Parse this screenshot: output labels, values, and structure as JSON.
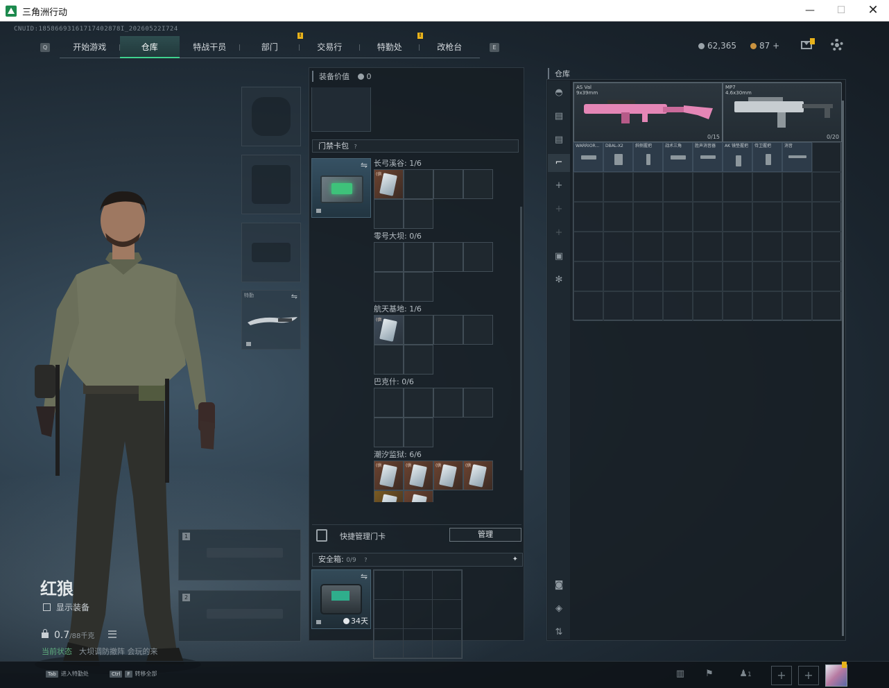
{
  "window": {
    "title": "三角洲行动",
    "min_label": "—",
    "max_label": "☐",
    "close_label": "✕"
  },
  "header": {
    "uid": "CNUID:18586693161717402878I_20260522I724",
    "left_btn": "Q",
    "right_btn": "E",
    "tabs": [
      {
        "label": "开始游戏",
        "active": false,
        "badge": ""
      },
      {
        "label": "仓库",
        "active": true,
        "badge": ""
      },
      {
        "label": "特战干员",
        "active": false,
        "badge": ""
      },
      {
        "label": "部门",
        "active": false,
        "badge": "!"
      },
      {
        "label": "交易行",
        "active": false,
        "badge": ""
      },
      {
        "label": "特勤处",
        "active": false,
        "badge": "!"
      },
      {
        "label": "改枪台",
        "active": false,
        "badge": ""
      }
    ],
    "currency_silver": "62,365",
    "currency_gold": "87 +",
    "colors": {
      "accent": "#3fd38e",
      "badge": "#e8b21a"
    }
  },
  "operator": {
    "name": "红狼",
    "show_equipment": "显示装备",
    "weight_value": "0.7",
    "weight_unit": "/88千克",
    "status": "当前状态",
    "status_note": "大坝调防撤阵 会玩的来"
  },
  "slots": {
    "melee_tag": "特勤",
    "weapon1_num": "1",
    "weapon2_num": "2"
  },
  "middle": {
    "equip_value_label": "装备价值",
    "equip_value": "0",
    "keycard_header": "门禁卡包",
    "keycard_help": "?",
    "maps": [
      {
        "label": "长弓溪谷: 1/6",
        "filled": 1
      },
      {
        "label": "零号大坝: 0/6",
        "filled": 0
      },
      {
        "label": "航天基地: 1/6",
        "filled": 1
      },
      {
        "label": "巴克什: 0/6",
        "filled": 0
      },
      {
        "label": "潮汐监狱: 6/6",
        "filled": 6
      }
    ],
    "card_mini_tags": [
      "(供",
      "(供",
      "(供",
      "(供"
    ],
    "quick_manage": "快捷管理门卡",
    "manage_button": "管理",
    "safebox_label": "安全箱: ",
    "safebox_count": "0/9",
    "safebox_help": "?",
    "safebox_days": "34天"
  },
  "warehouse": {
    "title": "仓库",
    "guns": [
      {
        "name": "AS Val",
        "caliber": "9x39mm",
        "count": "0/15"
      },
      {
        "name": "MP7",
        "caliber": "4.6x30mm",
        "count": "0/20"
      }
    ],
    "accessories": [
      "WARRIOR...",
      "DBAL-X2",
      "斜侧握把",
      "战术三角",
      "胜声消音器",
      "AK 镜垫握把",
      "侍卫握把",
      "消音"
    ],
    "side_icons": [
      "helmet-icon",
      "layer-icon",
      "layer-icon",
      "gun-icon",
      "plus-icon",
      "plus-icon",
      "plus-icon",
      "lock-icon",
      "gear-icon"
    ]
  },
  "bottom": {
    "hint1_key": "Tab",
    "hint1_text": "进入特勤处",
    "hint2_key1": "Ctrl",
    "hint2_key2": "F",
    "hint2_text": "转移全部",
    "friends_count": "1",
    "plus": "+"
  }
}
